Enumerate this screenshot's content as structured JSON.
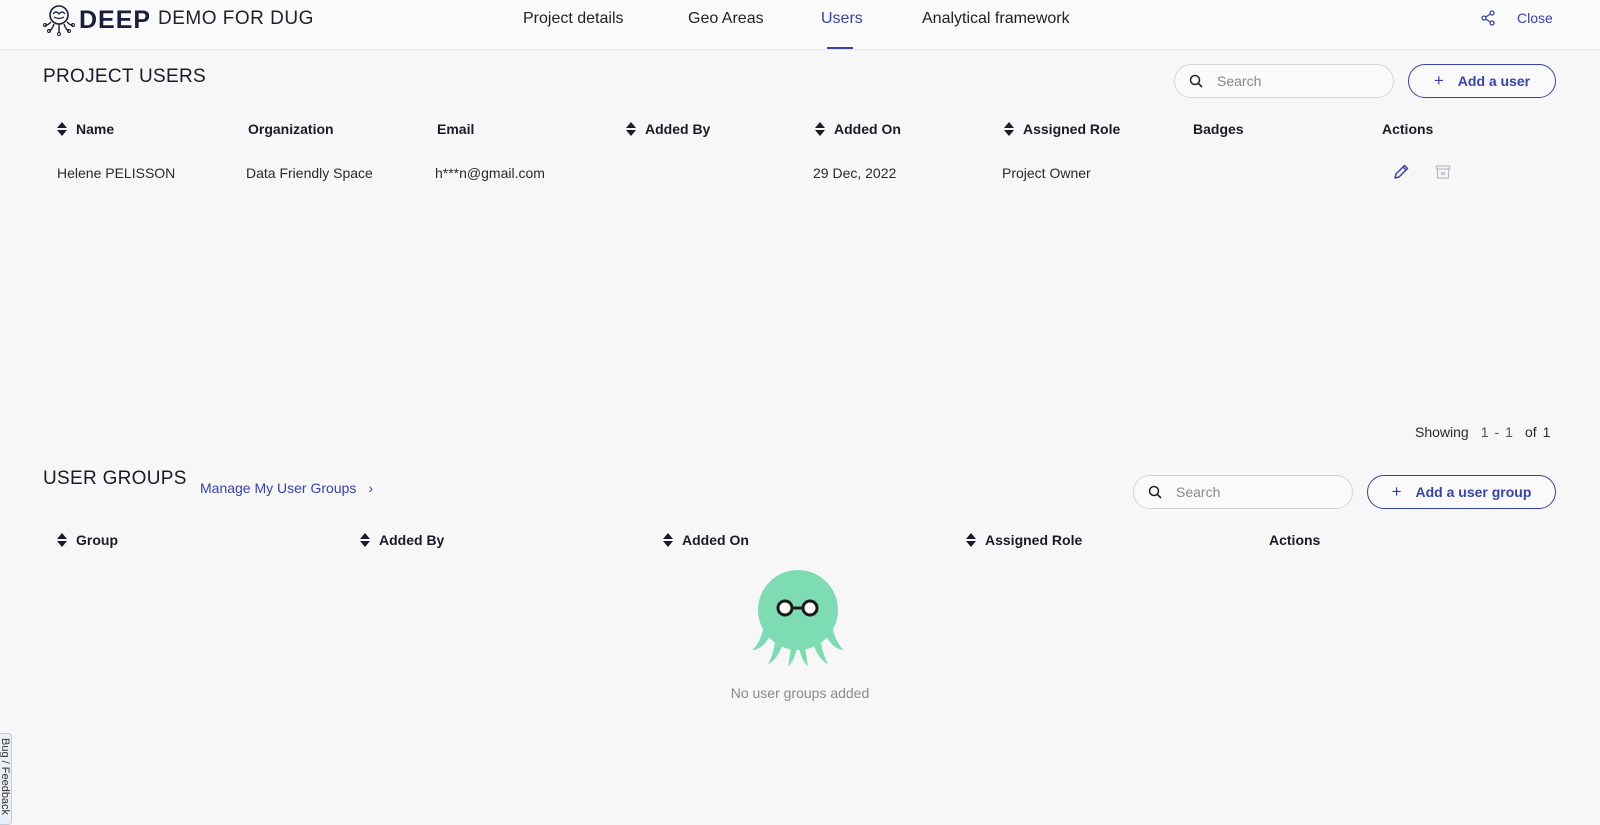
{
  "header": {
    "logo_text": "DEEP",
    "project_title": "DEMO FOR DUG",
    "tabs": [
      {
        "label": "Project details",
        "active": false
      },
      {
        "label": "Geo Areas",
        "active": false
      },
      {
        "label": "Users",
        "active": true
      },
      {
        "label": "Analytical framework",
        "active": false
      }
    ],
    "share_icon": "share-icon",
    "close_label": "Close"
  },
  "project_users": {
    "title": "PROJECT USERS",
    "search_placeholder": "Search",
    "add_button_label": "Add a user",
    "columns": [
      "Name",
      "Organization",
      "Email",
      "Added By",
      "Added On",
      "Assigned Role",
      "Badges",
      "Actions"
    ],
    "rows": [
      {
        "name": "Helene PELISSON",
        "organization": "Data Friendly Space",
        "email": "h***n@gmail.com",
        "added_by": "",
        "added_on": "29 Dec, 2022",
        "assigned_role": "Project Owner",
        "badges": ""
      }
    ],
    "pager": {
      "label": "Showing",
      "from": "1",
      "sep": "-",
      "to": "1",
      "of_label": "of",
      "total": "1"
    }
  },
  "user_groups": {
    "title": "USER GROUPS",
    "manage_link_label": "Manage My User Groups",
    "search_placeholder": "Search",
    "add_button_label": "Add a user group",
    "columns": [
      "Group",
      "Added By",
      "Added On",
      "Assigned Role",
      "Actions"
    ],
    "empty_message": "No user groups added"
  },
  "feedback_tab_label": "Bug / Feedback",
  "colors": {
    "accent": "#3742b0",
    "background": "#f7f7f7",
    "mascot": "#7ddcb4"
  }
}
